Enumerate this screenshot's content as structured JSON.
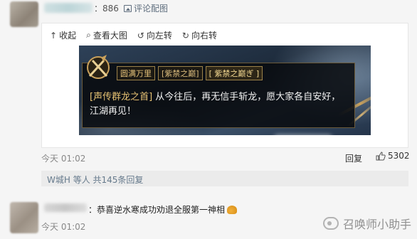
{
  "top_comment": {
    "likes": "：886",
    "pic_comment_label": "评论配图"
  },
  "toolbar": {
    "collapse": "收起",
    "view_large": "查看大图",
    "rotate_left": "向左转",
    "rotate_right": "向右转"
  },
  "game": {
    "chips": [
      "圆满万里",
      "[紫禁之巅]",
      "[ 紫禁之巅ぎ ]"
    ],
    "message_tag": "[声传群龙之首]",
    "message_text": " 从今往后，再无信手斩龙，愿大家各自安好，江湖再见！"
  },
  "meta": {
    "time": "今天 01:02",
    "reply": "回复",
    "likes": "5302"
  },
  "replies_summary": "W城H 等人 共145条回复",
  "second_comment": {
    "text": "：恭喜逆水寒成功劝退全服第一神相",
    "time": "今天 01:02"
  },
  "watermark": "召唤师小助手",
  "icons": {
    "pic_comment": "image-icon",
    "collapse": "arrow-up-icon",
    "view_large": "search-icon",
    "rotate_left": "rotate-left-icon",
    "rotate_right": "rotate-right-icon",
    "like": "thumbs-up-icon"
  }
}
